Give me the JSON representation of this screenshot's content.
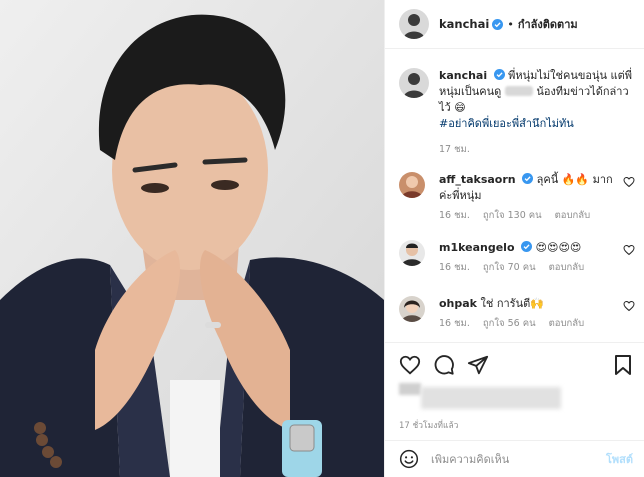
{
  "post": {
    "author": "kanchai",
    "follow_status": "กำลังติดตาม",
    "dot": "•"
  },
  "caption": {
    "username": "kanchai",
    "text_before": "พี่หนุ่มไม่ใช่คนขอนุ่น แต่พี่หนุ่มเป็นคนดู",
    "text_after": "น้องทีมข่าวได้กล่าวไว้ 😄",
    "hashtag": "#อย่าคิดพี่เยอะพี่สำนึกไม่ทัน",
    "time": "17 ชม."
  },
  "comments": [
    {
      "username": "aff_taksaorn",
      "text": "ลุคนี้ 🔥🔥 มากค่ะพี่หนุ่ม",
      "time": "16 ชม.",
      "likes": "ถูกใจ 130 คน",
      "reply": "ตอบกลับ"
    },
    {
      "username": "m1keangelo",
      "text": "😍😍😍😍",
      "time": "16 ชม.",
      "likes": "ถูกใจ 70 คน",
      "reply": "ตอบกลับ"
    },
    {
      "username": "ohpak",
      "text": "ใช่ การันตี🙌",
      "time": "16 ชม.",
      "likes": "ถูกใจ 56 คน",
      "reply": "ตอบกลับ"
    }
  ],
  "timestamp": "17 ชั่วโมงที่แล้ว",
  "add_comment": {
    "placeholder": "เพิ่มความคิดเห็น",
    "post_label": "โพสต์"
  },
  "icons": {
    "verified": "verified-badge-icon",
    "like": "heart-icon",
    "comment": "comment-icon",
    "share": "share-icon",
    "save": "bookmark-icon",
    "emoji": "emoji-icon"
  },
  "colors": {
    "verified": "#3897f0",
    "link": "#00376b",
    "muted": "#8e8e8e",
    "post_disabled": "#b2dffc"
  }
}
